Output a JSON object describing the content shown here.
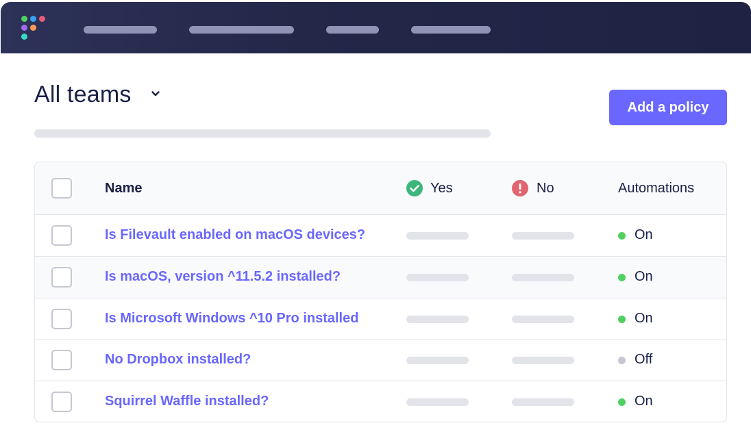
{
  "header": {
    "logo_dot_colors": [
      "#4fd061",
      "#3e9ff2",
      "#e65a7c",
      "#a06aef",
      "#ff9b57",
      "#3ad9c4"
    ],
    "nav_placeholders": 4
  },
  "page": {
    "title": "All teams",
    "add_button_label": "Add a policy"
  },
  "table": {
    "columns": {
      "name": "Name",
      "yes": "Yes",
      "no": "No",
      "automations": "Automations"
    },
    "rows": [
      {
        "name": "Is Filevault enabled on macOS devices?",
        "automation": "On"
      },
      {
        "name": "Is macOS, version ^11.5.2 installed?",
        "automation": "On"
      },
      {
        "name": "Is Microsoft Windows ^10 Pro installed",
        "automation": "On"
      },
      {
        "name": "No Dropbox installed?",
        "automation": "Off"
      },
      {
        "name": "Squirrel Waffle installed?",
        "automation": "On"
      }
    ]
  },
  "colors": {
    "accent": "#6a67fe",
    "on": "#4fd061",
    "off": "#c5c7d1",
    "yes": "#3db67b",
    "no": "#e0656f"
  }
}
